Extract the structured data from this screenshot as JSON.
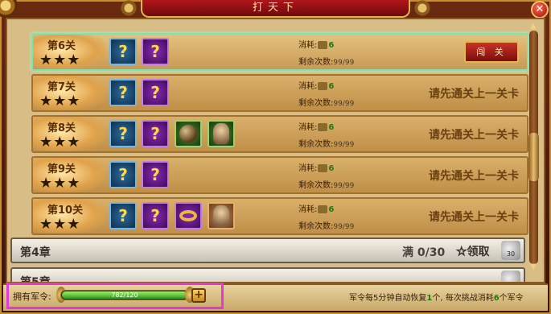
{
  "window": {
    "title": "打天下",
    "close_symbol": "✕"
  },
  "levels": [
    {
      "name": "第6关",
      "stars": "★★★",
      "rewards": [
        "?",
        "?"
      ],
      "cost_label": "消耗:",
      "cost_value": "6",
      "remaining_label": "剩余次数:",
      "remaining_value": "99/99",
      "action": "闯 关",
      "unlocked": true
    },
    {
      "name": "第7关",
      "stars": "★★★",
      "rewards": [
        "?",
        "?"
      ],
      "cost_label": "消耗:",
      "cost_value": "6",
      "remaining_label": "剩余次数:",
      "remaining_value": "99/99",
      "action": "请先通关上一关卡",
      "unlocked": false
    },
    {
      "name": "第8关",
      "stars": "★★★",
      "rewards": [
        "?",
        "?"
      ],
      "cost_label": "消耗:",
      "cost_value": "6",
      "remaining_label": "剩余次数:",
      "remaining_value": "99/99",
      "action": "请先通关上一关卡",
      "unlocked": false
    },
    {
      "name": "第9关",
      "stars": "★★★",
      "rewards": [
        "?",
        "?"
      ],
      "cost_label": "消耗:",
      "cost_value": "6",
      "remaining_label": "剩余次数:",
      "remaining_value": "99/99",
      "action": "请先通关上一关卡",
      "unlocked": false
    },
    {
      "name": "第10关",
      "stars": "★★★",
      "rewards": [
        "?",
        "?"
      ],
      "cost_label": "消耗:",
      "cost_value": "6",
      "remaining_label": "剩余次数:",
      "remaining_value": "99/99",
      "action": "请先通关上一关卡",
      "unlocked": false
    }
  ],
  "chapters": [
    {
      "name": "第4章",
      "full": "满 0/30",
      "claim": "领取",
      "chest_label": "30"
    },
    {
      "name": "第5章"
    }
  ],
  "footer": {
    "tokens_label": "拥有军令:",
    "tokens_value": "782/120",
    "tokens_fill_fraction": 1.0,
    "add_symbol": "+",
    "recovery_prefix": "军令每5分钟自动恢复",
    "recovery_num1": "1",
    "recovery_mid": "个, 每次挑战消耗",
    "recovery_num2": "6",
    "recovery_suffix": "个军令"
  },
  "colors": {
    "accent_red": "#b0161a",
    "gold": "#e2b34a",
    "highlight": "#e23ad8",
    "progress_green": "#2f9a18"
  }
}
